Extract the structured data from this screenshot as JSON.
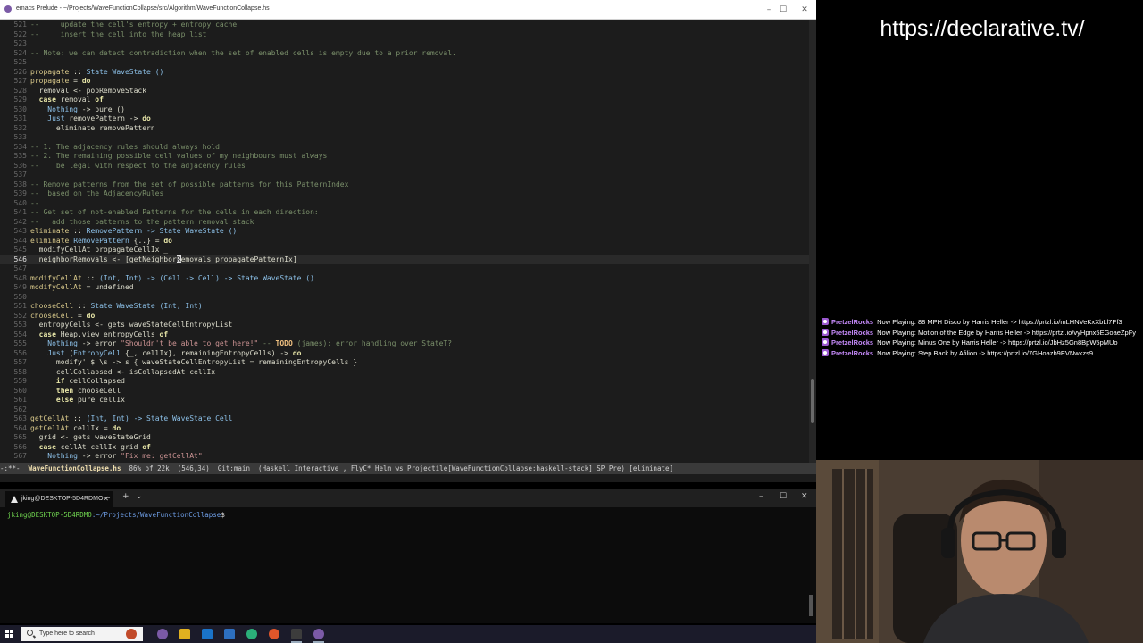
{
  "emacs": {
    "title": "emacs Prelude - ~/Projects/WaveFunctionCollapse/src/Algorithm/WaveFunctionCollapse.hs",
    "lines": [
      {
        "num": "521",
        "tokens": [
          {
            "t": "--     update the cell's entropy + entropy cache",
            "c": "com"
          }
        ]
      },
      {
        "num": "522",
        "tokens": [
          {
            "t": "--     insert the cell into the heap list",
            "c": "com"
          }
        ]
      },
      {
        "num": "523",
        "tokens": [
          {
            "t": "",
            "c": "n"
          }
        ]
      },
      {
        "num": "524",
        "tokens": [
          {
            "t": "-- Note: we can detect contradiction when the set of enabled cells is empty due to a prior removal.",
            "c": "com"
          }
        ]
      },
      {
        "num": "525",
        "tokens": [
          {
            "t": "",
            "c": "n"
          }
        ]
      },
      {
        "num": "526",
        "tokens": [
          {
            "t": "propagate",
            "c": "fn"
          },
          {
            "t": " :: ",
            "c": "n"
          },
          {
            "t": "State WaveState ()",
            "c": "ty"
          }
        ]
      },
      {
        "num": "527",
        "tokens": [
          {
            "t": "propagate",
            "c": "fn"
          },
          {
            "t": " = ",
            "c": "n"
          },
          {
            "t": "do",
            "c": "kw"
          }
        ]
      },
      {
        "num": "528",
        "tokens": [
          {
            "t": "  removal <- popRemoveStack",
            "c": "n"
          }
        ]
      },
      {
        "num": "529",
        "tokens": [
          {
            "t": "  ",
            "c": "n"
          },
          {
            "t": "case",
            "c": "kw"
          },
          {
            "t": " removal ",
            "c": "n"
          },
          {
            "t": "of",
            "c": "kw"
          }
        ]
      },
      {
        "num": "530",
        "tokens": [
          {
            "t": "    ",
            "c": "n"
          },
          {
            "t": "Nothing",
            "c": "ty"
          },
          {
            "t": " -> pure ()",
            "c": "n"
          }
        ]
      },
      {
        "num": "531",
        "tokens": [
          {
            "t": "    ",
            "c": "n"
          },
          {
            "t": "Just",
            "c": "ty"
          },
          {
            "t": " removePattern -> ",
            "c": "n"
          },
          {
            "t": "do",
            "c": "kw"
          }
        ]
      },
      {
        "num": "532",
        "tokens": [
          {
            "t": "      eliminate removePattern",
            "c": "n"
          }
        ]
      },
      {
        "num": "533",
        "tokens": [
          {
            "t": "",
            "c": "n"
          }
        ]
      },
      {
        "num": "534",
        "tokens": [
          {
            "t": "-- 1. The adjacency rules should always hold",
            "c": "com"
          }
        ]
      },
      {
        "num": "535",
        "tokens": [
          {
            "t": "-- 2. The remaining possible cell values of my neighbours must always",
            "c": "com"
          }
        ]
      },
      {
        "num": "536",
        "tokens": [
          {
            "t": "--    be legal with respect to the adjacency rules",
            "c": "com"
          }
        ]
      },
      {
        "num": "537",
        "tokens": [
          {
            "t": "",
            "c": "n"
          }
        ]
      },
      {
        "num": "538",
        "tokens": [
          {
            "t": "-- Remove patterns from the set of possible patterns for this PatternIndex",
            "c": "com"
          }
        ]
      },
      {
        "num": "539",
        "tokens": [
          {
            "t": "--  based on the AdjacencyRules",
            "c": "com"
          }
        ]
      },
      {
        "num": "540",
        "tokens": [
          {
            "t": "--",
            "c": "com"
          }
        ]
      },
      {
        "num": "541",
        "tokens": [
          {
            "t": "-- Get set of not-enabled Patterns for the cells in each direction:",
            "c": "com"
          }
        ]
      },
      {
        "num": "542",
        "tokens": [
          {
            "t": "--   add those patterns to the pattern removal stack",
            "c": "com"
          }
        ]
      },
      {
        "num": "543",
        "tokens": [
          {
            "t": "eliminate",
            "c": "fn"
          },
          {
            "t": " :: ",
            "c": "n"
          },
          {
            "t": "RemovePattern -> State WaveState ()",
            "c": "ty"
          }
        ]
      },
      {
        "num": "544",
        "tokens": [
          {
            "t": "eliminate",
            "c": "fn"
          },
          {
            "t": " ",
            "c": "n"
          },
          {
            "t": "RemovePattern",
            "c": "ty"
          },
          {
            "t": " {..} = ",
            "c": "n"
          },
          {
            "t": "do",
            "c": "kw"
          }
        ]
      },
      {
        "num": "545",
        "tokens": [
          {
            "t": "  modifyCellAt propagateCellIx _",
            "c": "n"
          }
        ]
      },
      {
        "num": "546",
        "current": true,
        "tokens": [
          {
            "t": "  neighborRemovals <- [getNeighbor",
            "c": "n"
          },
          {
            "t": "R",
            "c": "cursor"
          },
          {
            "t": "emovals propagatePatternIx]",
            "c": "n"
          }
        ]
      },
      {
        "num": "547",
        "tokens": [
          {
            "t": "",
            "c": "n"
          }
        ]
      },
      {
        "num": "548",
        "tokens": [
          {
            "t": "modifyCellAt",
            "c": "fn"
          },
          {
            "t": " :: ",
            "c": "n"
          },
          {
            "t": "(Int, Int) -> (Cell -> Cell) -> State WaveState ()",
            "c": "ty"
          }
        ]
      },
      {
        "num": "549",
        "tokens": [
          {
            "t": "modifyCellAt",
            "c": "fn"
          },
          {
            "t": " = undefined",
            "c": "n"
          }
        ]
      },
      {
        "num": "550",
        "tokens": [
          {
            "t": "",
            "c": "n"
          }
        ]
      },
      {
        "num": "551",
        "tokens": [
          {
            "t": "chooseCell",
            "c": "fn"
          },
          {
            "t": " :: ",
            "c": "n"
          },
          {
            "t": "State WaveState (Int, Int)",
            "c": "ty"
          }
        ]
      },
      {
        "num": "552",
        "tokens": [
          {
            "t": "chooseCell",
            "c": "fn"
          },
          {
            "t": " = ",
            "c": "n"
          },
          {
            "t": "do",
            "c": "kw"
          }
        ]
      },
      {
        "num": "553",
        "tokens": [
          {
            "t": "  entropyCells <- gets waveStateCellEntropyList",
            "c": "n"
          }
        ]
      },
      {
        "num": "554",
        "tokens": [
          {
            "t": "  ",
            "c": "n"
          },
          {
            "t": "case",
            "c": "kw"
          },
          {
            "t": " Heap.view entropyCells ",
            "c": "n"
          },
          {
            "t": "of",
            "c": "kw"
          }
        ]
      },
      {
        "num": "555",
        "tokens": [
          {
            "t": "    ",
            "c": "n"
          },
          {
            "t": "Nothing",
            "c": "ty"
          },
          {
            "t": " -> error ",
            "c": "n"
          },
          {
            "t": "\"Shouldn't be able to get here!\"",
            "c": "str"
          },
          {
            "t": " -- ",
            "c": "com"
          },
          {
            "t": "TODO",
            "c": "todo"
          },
          {
            "t": " (james): error handling over StateT?",
            "c": "com"
          }
        ]
      },
      {
        "num": "556",
        "tokens": [
          {
            "t": "    ",
            "c": "n"
          },
          {
            "t": "Just",
            "c": "ty"
          },
          {
            "t": " (",
            "c": "n"
          },
          {
            "t": "EntropyCell",
            "c": "ty"
          },
          {
            "t": " {_, cellIx}, remainingEntropyCells) -> ",
            "c": "n"
          },
          {
            "t": "do",
            "c": "kw"
          }
        ]
      },
      {
        "num": "557",
        "tokens": [
          {
            "t": "      modify' $ \\s -> s { waveStateCellEntropyList = remainingEntropyCells }",
            "c": "n"
          }
        ]
      },
      {
        "num": "558",
        "tokens": [
          {
            "t": "      cellCollapsed <- isCollapsedAt cellIx",
            "c": "n"
          }
        ]
      },
      {
        "num": "559",
        "tokens": [
          {
            "t": "      ",
            "c": "n"
          },
          {
            "t": "if",
            "c": "kw"
          },
          {
            "t": " cellCollapsed",
            "c": "n"
          }
        ]
      },
      {
        "num": "560",
        "tokens": [
          {
            "t": "      ",
            "c": "n"
          },
          {
            "t": "then",
            "c": "kw"
          },
          {
            "t": " chooseCell",
            "c": "n"
          }
        ]
      },
      {
        "num": "561",
        "tokens": [
          {
            "t": "      ",
            "c": "n"
          },
          {
            "t": "else",
            "c": "kw"
          },
          {
            "t": " pure cellIx",
            "c": "n"
          }
        ]
      },
      {
        "num": "562",
        "tokens": [
          {
            "t": "",
            "c": "n"
          }
        ]
      },
      {
        "num": "563",
        "tokens": [
          {
            "t": "getCellAt",
            "c": "fn"
          },
          {
            "t": " :: ",
            "c": "n"
          },
          {
            "t": "(Int, Int) -> State WaveState Cell",
            "c": "ty"
          }
        ]
      },
      {
        "num": "564",
        "tokens": [
          {
            "t": "getCellAt",
            "c": "fn"
          },
          {
            "t": " cellIx = ",
            "c": "n"
          },
          {
            "t": "do",
            "c": "kw"
          }
        ]
      },
      {
        "num": "565",
        "tokens": [
          {
            "t": "  grid <- gets waveStateGrid",
            "c": "n"
          }
        ]
      },
      {
        "num": "566",
        "tokens": [
          {
            "t": "  ",
            "c": "n"
          },
          {
            "t": "case",
            "c": "kw"
          },
          {
            "t": " cellAt cellIx grid ",
            "c": "n"
          },
          {
            "t": "of",
            "c": "kw"
          }
        ]
      },
      {
        "num": "567",
        "tokens": [
          {
            "t": "    ",
            "c": "n"
          },
          {
            "t": "Nothing",
            "c": "ty"
          },
          {
            "t": " -> error ",
            "c": "n"
          },
          {
            "t": "\"Fix me: getCellAt\"",
            "c": "str"
          }
        ]
      },
      {
        "num": "568",
        "tokens": [
          {
            "t": "    ",
            "c": "n"
          },
          {
            "t": "Just",
            "c": "ty"
          },
          {
            "t": " cell -> pure cell",
            "c": "n"
          }
        ]
      }
    ],
    "modeline": {
      "prefix": "-:**-",
      "file": "WaveFunctionCollapse.hs",
      "rest": "86% of 22k  (546,34)  Git:main  (Haskell Interactive , FlyC* Helm ws Projectile[WaveFunctionCollapse:haskell-stack] SP Pre) [eliminate]"
    }
  },
  "terminal": {
    "tab_title": "jking@DESKTOP-5D4RDMO: ~",
    "user_host": "jking@DESKTOP-5D4RDMO",
    "path": ":~/Projects/WaveFunctionCollapse",
    "prompt_end": "$"
  },
  "taskbar": {
    "search_placeholder": "Type here to search"
  },
  "stream": {
    "url": "https://declarative.tv/"
  },
  "chat": [
    {
      "user": "PretzelRocks",
      "text": "Now Playing: 88 MPH Disco by Harris Heller -> https://prtzl.io/mLHNVeKxXbLl7Pf3"
    },
    {
      "user": "PretzelRocks",
      "text": "Now Playing: Motion of the Edge by Harris Heller -> https://prtzl.io/vyHpnx5EGoaeZpFy"
    },
    {
      "user": "PretzelRocks",
      "text": "Now Playing: Minus One by Harris Heller -> https://prtzl.io/JbHz5Gn8BpW5pMUo"
    },
    {
      "user": "PretzelRocks",
      "text": "Now Playing: Step Back by Afilion -> https://prtzl.io/7GHoazb9EVNwkzs9"
    }
  ],
  "colors": {
    "editor_bg": "#1c1c1c",
    "comment": "#7a8f6a",
    "keyword": "#e8e6a8",
    "type": "#8cc0e8",
    "string": "#cc9393",
    "chat_badge": "#9b59d0"
  }
}
